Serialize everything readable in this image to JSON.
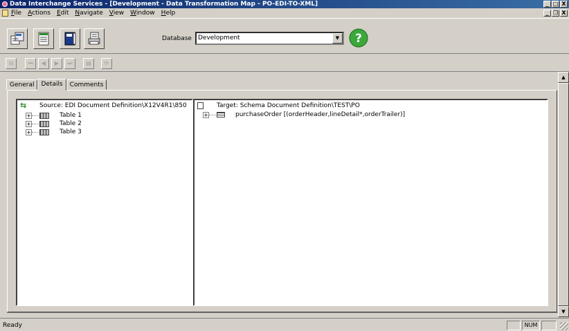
{
  "window": {
    "title": "Data Interchange Services - [Development - Data Transformation Map - PO-EDI-TO-XML]",
    "minimize": "_",
    "maximize": "□",
    "close": "X",
    "titlebar_color": "#0a246a"
  },
  "menubar": {
    "items": [
      "File",
      "Actions",
      "Edit",
      "Navigate",
      "View",
      "Window",
      "Help"
    ],
    "mdi_minimize": "_",
    "mdi_restore": "❐",
    "mdi_close": "X"
  },
  "toolbar": {
    "icons": [
      "xml-document-icon",
      "form-document-icon",
      "edi-book-icon",
      "printer-document-icon"
    ],
    "database_label": "Database",
    "database_value": "Development",
    "help_icon": "help-icon",
    "help_color": "#3aa83a"
  },
  "navbar": {
    "buttons": [
      "⊟",
      "⏮",
      "◀",
      "▶",
      "⏭",
      "▤",
      "⟳"
    ]
  },
  "tabs": [
    {
      "label": "General",
      "active": false
    },
    {
      "label": "Details",
      "active": true
    },
    {
      "label": "Comments",
      "active": false
    }
  ],
  "source": {
    "header": "Source: EDI Document Definition\\X12V4R1\\850",
    "items": [
      "Table 1",
      "Table 2",
      "Table 3"
    ]
  },
  "target": {
    "header": "Target: Schema Document Definition\\TEST\\PO",
    "items": [
      "purchaseOrder [(orderHeader,lineDetail*,orderTrailer)]"
    ]
  },
  "statusbar": {
    "text": "Ready",
    "num": "NUM"
  }
}
